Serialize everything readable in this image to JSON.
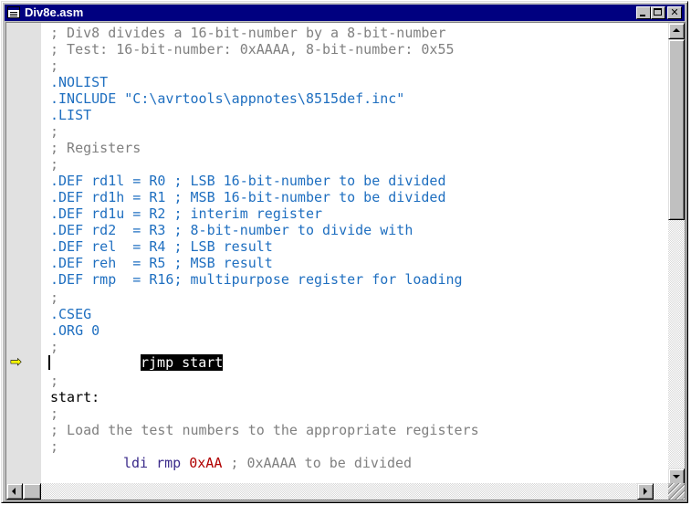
{
  "window": {
    "title": "Div8e.asm",
    "icon": "document-icon",
    "controls": [
      "minimize-icon",
      "maximize-icon",
      "close-icon"
    ]
  },
  "editor": {
    "lines": [
      "; Div8 divides a 16-bit-number by a 8-bit-number",
      "; Test: 16-bit-number: 0xAAAA, 8-bit-number: 0x55",
      ";",
      ".NOLIST",
      ".INCLUDE \"C:\\avrtools\\appnotes\\8515def.inc\"",
      ".LIST",
      ";",
      "; Registers",
      ";",
      ".DEF rd1l = R0 ; LSB 16-bit-number to be divided",
      ".DEF rd1h = R1 ; MSB 16-bit-number to be divided",
      ".DEF rd1u = R2 ; interim register",
      ".DEF rd2  = R3 ; 8-bit-number to divide with",
      ".DEF rel  = R4 ; LSB result",
      ".DEF reh  = R5 ; MSB result",
      ".DEF rmp  = R16; multipurpose register for loading",
      ";",
      ".CSEG",
      ".ORG 0",
      ";",
      "rjmp start",
      ";",
      "start:",
      ";",
      "; Load the test numbers to the appropriate registers",
      ";",
      "ldi rmp",
      "0xAA",
      "; 0xAAAA to be divided"
    ],
    "breakpoint_icon": "current-line-arrow-icon"
  },
  "scrollbars": {
    "vertical": {
      "up_icon": "arrow-up-icon",
      "down_icon": "arrow-down-icon",
      "position": 0
    },
    "horizontal": {
      "left_icon": "arrow-left-icon",
      "right_icon": "arrow-right-icon",
      "position": 0
    }
  },
  "colors": {
    "titlebar": "#000080",
    "comment": "#808080",
    "directive": "#1f6fc0",
    "instruction": "#3a2a8a",
    "number": "#b00000"
  }
}
